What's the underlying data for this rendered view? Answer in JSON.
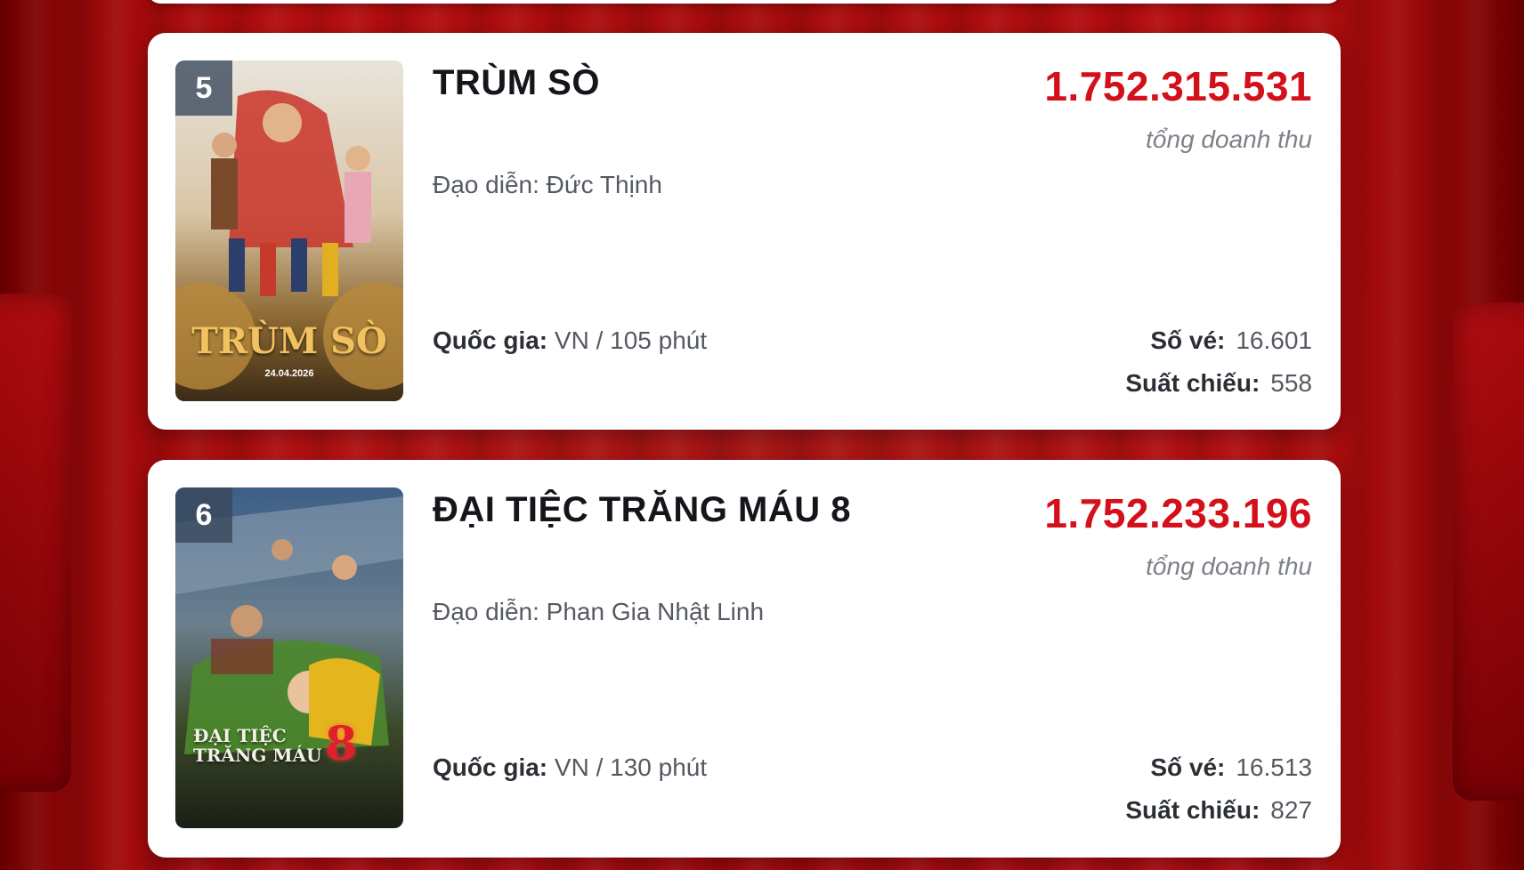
{
  "revenue_caption": "tổng doanh thu",
  "labels": {
    "director": "Đạo diễn:",
    "country": "Quốc gia:",
    "tickets": "Số vé:",
    "showings": "Suất chiếu:"
  },
  "movies": [
    {
      "rank": "5",
      "title": "TRÙM SÒ",
      "director": "Đức Thịnh",
      "country_duration": "VN / 105 phút",
      "revenue": "1.752.315.531",
      "tickets": "16.601",
      "showings": "558",
      "poster_title": "TRÙM SÒ",
      "poster_date": "24.04.2026"
    },
    {
      "rank": "6",
      "title": "ĐẠI TIỆC TRĂNG MÁU 8",
      "director": "Phan Gia Nhật Linh",
      "country_duration": "VN / 130 phút",
      "revenue": "1.752.233.196",
      "tickets": "16.513",
      "showings": "827",
      "poster_title_line1": "ĐẠI TIỆC",
      "poster_title_line2": "TRĂNG MÁU",
      "poster_numeral": "8"
    }
  ],
  "colors": {
    "revenue": "#d4101b",
    "background_curtain": "#a60b0c",
    "card": "#ffffff"
  }
}
